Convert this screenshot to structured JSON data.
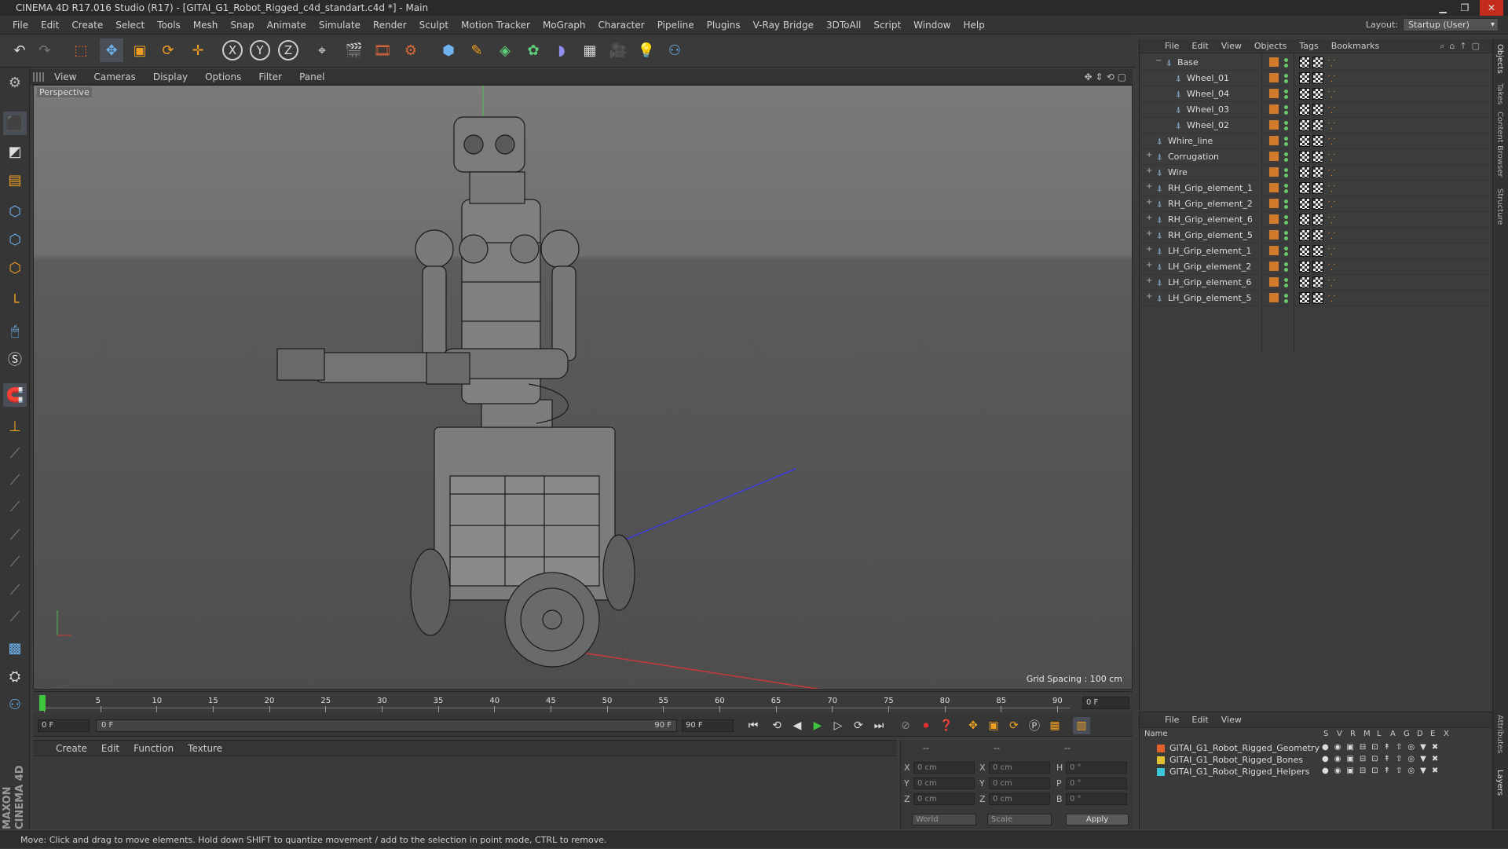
{
  "window": {
    "title": "CINEMA 4D R17.016 Studio (R17) - [GITAI_G1_Robot_Rigged_c4d_standart.c4d *] - Main"
  },
  "menubar": {
    "items": [
      "File",
      "Edit",
      "Create",
      "Select",
      "Tools",
      "Mesh",
      "Snap",
      "Animate",
      "Simulate",
      "Render",
      "Sculpt",
      "Motion Tracker",
      "MoGraph",
      "Character",
      "Pipeline",
      "Plugins",
      "V-Ray Bridge",
      "3DToAll",
      "Script",
      "Window",
      "Help"
    ],
    "layout_label": "Layout:",
    "layout_value": "Startup (User)"
  },
  "toolbar": {
    "axis_x": "X",
    "axis_y": "Y",
    "axis_z": "Z"
  },
  "viewport": {
    "menu": [
      "View",
      "Cameras",
      "Display",
      "Options",
      "Filter",
      "Panel"
    ],
    "camera_label": "Perspective",
    "grid_spacing": "Grid Spacing : 100 cm"
  },
  "timeline": {
    "ticks": [
      "0",
      "5",
      "10",
      "15",
      "20",
      "25",
      "30",
      "35",
      "40",
      "45",
      "50",
      "55",
      "60",
      "65",
      "70",
      "75",
      "80",
      "85",
      "90"
    ],
    "current_frame": "0 F",
    "start_field": "0 F",
    "range_start": "0 F",
    "range_end": "90 F",
    "end_field": "90 F"
  },
  "material_manager": {
    "menu": [
      "Create",
      "Edit",
      "Function",
      "Texture"
    ]
  },
  "coordinates": {
    "headers": [
      "--",
      "--",
      "--"
    ],
    "rows": [
      {
        "a": "X",
        "av": "0 cm",
        "b": "X",
        "bv": "0 cm",
        "c": "H",
        "cv": "0 °"
      },
      {
        "a": "Y",
        "av": "0 cm",
        "b": "Y",
        "bv": "0 cm",
        "c": "P",
        "cv": "0 °"
      },
      {
        "a": "Z",
        "av": "0 cm",
        "b": "Z",
        "bv": "0 cm",
        "c": "B",
        "cv": "0 °"
      }
    ],
    "mode1": "World",
    "mode2": "Scale",
    "apply": "Apply"
  },
  "object_manager": {
    "menu": [
      "File",
      "Edit",
      "View",
      "Objects",
      "Tags",
      "Bookmarks"
    ],
    "objects": [
      {
        "name": "Base",
        "indent": 2,
        "expand": "−"
      },
      {
        "name": "Wheel_01",
        "indent": 3,
        "expand": ""
      },
      {
        "name": "Wheel_04",
        "indent": 3,
        "expand": ""
      },
      {
        "name": "Wheel_03",
        "indent": 3,
        "expand": ""
      },
      {
        "name": "Wheel_02",
        "indent": 3,
        "expand": ""
      },
      {
        "name": "Whire_line",
        "indent": 1,
        "expand": ""
      },
      {
        "name": "Corrugation",
        "indent": 1,
        "expand": "+"
      },
      {
        "name": "Wire",
        "indent": 1,
        "expand": "+"
      },
      {
        "name": "RH_Grip_element_1",
        "indent": 1,
        "expand": "+"
      },
      {
        "name": "RH_Grip_element_2",
        "indent": 1,
        "expand": "+"
      },
      {
        "name": "RH_Grip_element_6",
        "indent": 1,
        "expand": "+"
      },
      {
        "name": "RH_Grip_element_5",
        "indent": 1,
        "expand": "+"
      },
      {
        "name": "LH_Grip_element_1",
        "indent": 1,
        "expand": "+"
      },
      {
        "name": "LH_Grip_element_2",
        "indent": 1,
        "expand": "+"
      },
      {
        "name": "LH_Grip_element_6",
        "indent": 1,
        "expand": "+"
      },
      {
        "name": "LH_Grip_element_5",
        "indent": 1,
        "expand": "+"
      }
    ]
  },
  "layers": {
    "menu": [
      "File",
      "Edit",
      "View"
    ],
    "columns": [
      "Name",
      "S",
      "V",
      "R",
      "M",
      "L",
      "A",
      "G",
      "D",
      "E",
      "X"
    ],
    "items": [
      {
        "name": "GITAI_G1_Robot_Rigged_Geometry",
        "color": "#e0622a"
      },
      {
        "name": "GITAI_G1_Robot_Rigged_Bones",
        "color": "#e2c232"
      },
      {
        "name": "GITAI_G1_Robot_Rigged_Helpers",
        "color": "#3ac8d8"
      }
    ]
  },
  "sidetabs": [
    "Objects",
    "Takes",
    "Content Browser",
    "Structure",
    "Attributes",
    "Layers"
  ],
  "brand": "MAXON CINEMA 4D",
  "status": "Move: Click and drag to move elements. Hold down SHIFT to quantize movement / add to the selection in point mode, CTRL to remove."
}
